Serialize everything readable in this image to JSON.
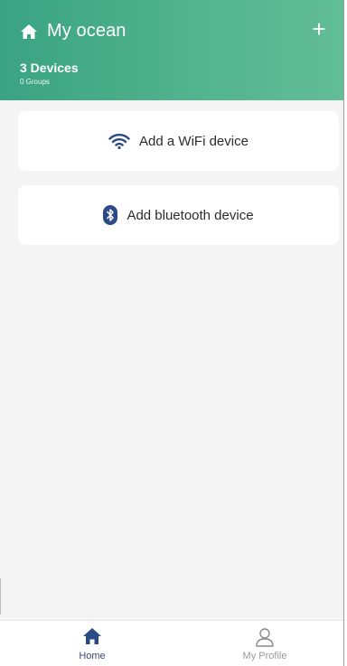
{
  "header": {
    "home_name": "My ocean",
    "device_count": "3 Devices",
    "group_count": "0 Groups",
    "add_symbol": "+",
    "home_icon": "home-icon"
  },
  "cards": {
    "wifi": {
      "label": "Add a WiFi device",
      "icon": "wifi-icon",
      "icon_color": "#2c4a86"
    },
    "bluetooth": {
      "label": "Add bluetooth device",
      "icon": "bluetooth-icon",
      "icon_color": "#2c4a86"
    }
  },
  "tabbar": {
    "home_label": "Home",
    "home_icon": "home-icon",
    "profile_label": "My Profile",
    "profile_icon": "user-icon",
    "active_color": "#2c4a86",
    "inactive_color": "#9a9a9a"
  },
  "colors": {
    "header_gradient_start": "#3aa381",
    "header_gradient_end": "#62bd98",
    "background": "#f4f4f4",
    "card": "#ffffff"
  }
}
